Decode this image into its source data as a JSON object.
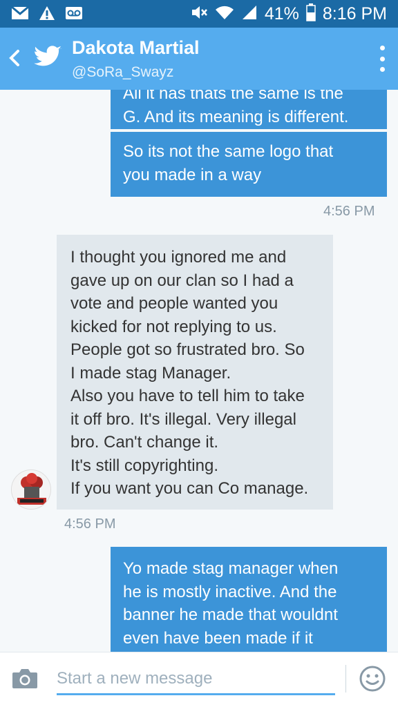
{
  "status_bar": {
    "battery": "41%",
    "time": "8:16 PM",
    "icons": [
      "gmail-icon",
      "warning-icon",
      "voicemail-icon",
      "mute-icon",
      "wifi-icon",
      "signal-icon",
      "battery-icon"
    ]
  },
  "header": {
    "title": "Dakota Martial",
    "handle": "@SoRa_Swayz",
    "icons": [
      "back-icon",
      "twitter-bird-icon",
      "more-vert-icon"
    ]
  },
  "messages": [
    {
      "direction": "out",
      "text": "All it has thats the same is the\nG. And its meaning is different."
    },
    {
      "direction": "out",
      "text": "So its not the same logo that\nyou made in a way"
    },
    {
      "timestamp": "4:56 PM"
    },
    {
      "direction": "in",
      "text": "I thought you ignored me and\ngave up on our clan so I had a\nvote and people wanted you\nkicked for not replying to us.\nPeople got so frustrated bro. So\nI made stag Manager.\nAlso you have to tell him to take\nit off bro. It's illegal. Very illegal\nbro. Can't change it.\nIt's still copyrighting.\nIf you want you can Co manage."
    },
    {
      "timestamp": "4:56 PM"
    },
    {
      "direction": "out",
      "text": "Yo made stag manager when\nhe is mostly inactive. And the\nbanner he made that wouldnt\neven have been made if it"
    }
  ],
  "composer": {
    "placeholder": "Start a new message",
    "value": "",
    "icons": [
      "camera-icon",
      "emoji-icon"
    ]
  },
  "colors": {
    "status_bar": "#1b6aa5",
    "app_bar": "#55acee",
    "outgoing_bubble": "#3c94d8",
    "incoming_bubble": "#e1e8ed",
    "timestamp": "#8899a6"
  }
}
